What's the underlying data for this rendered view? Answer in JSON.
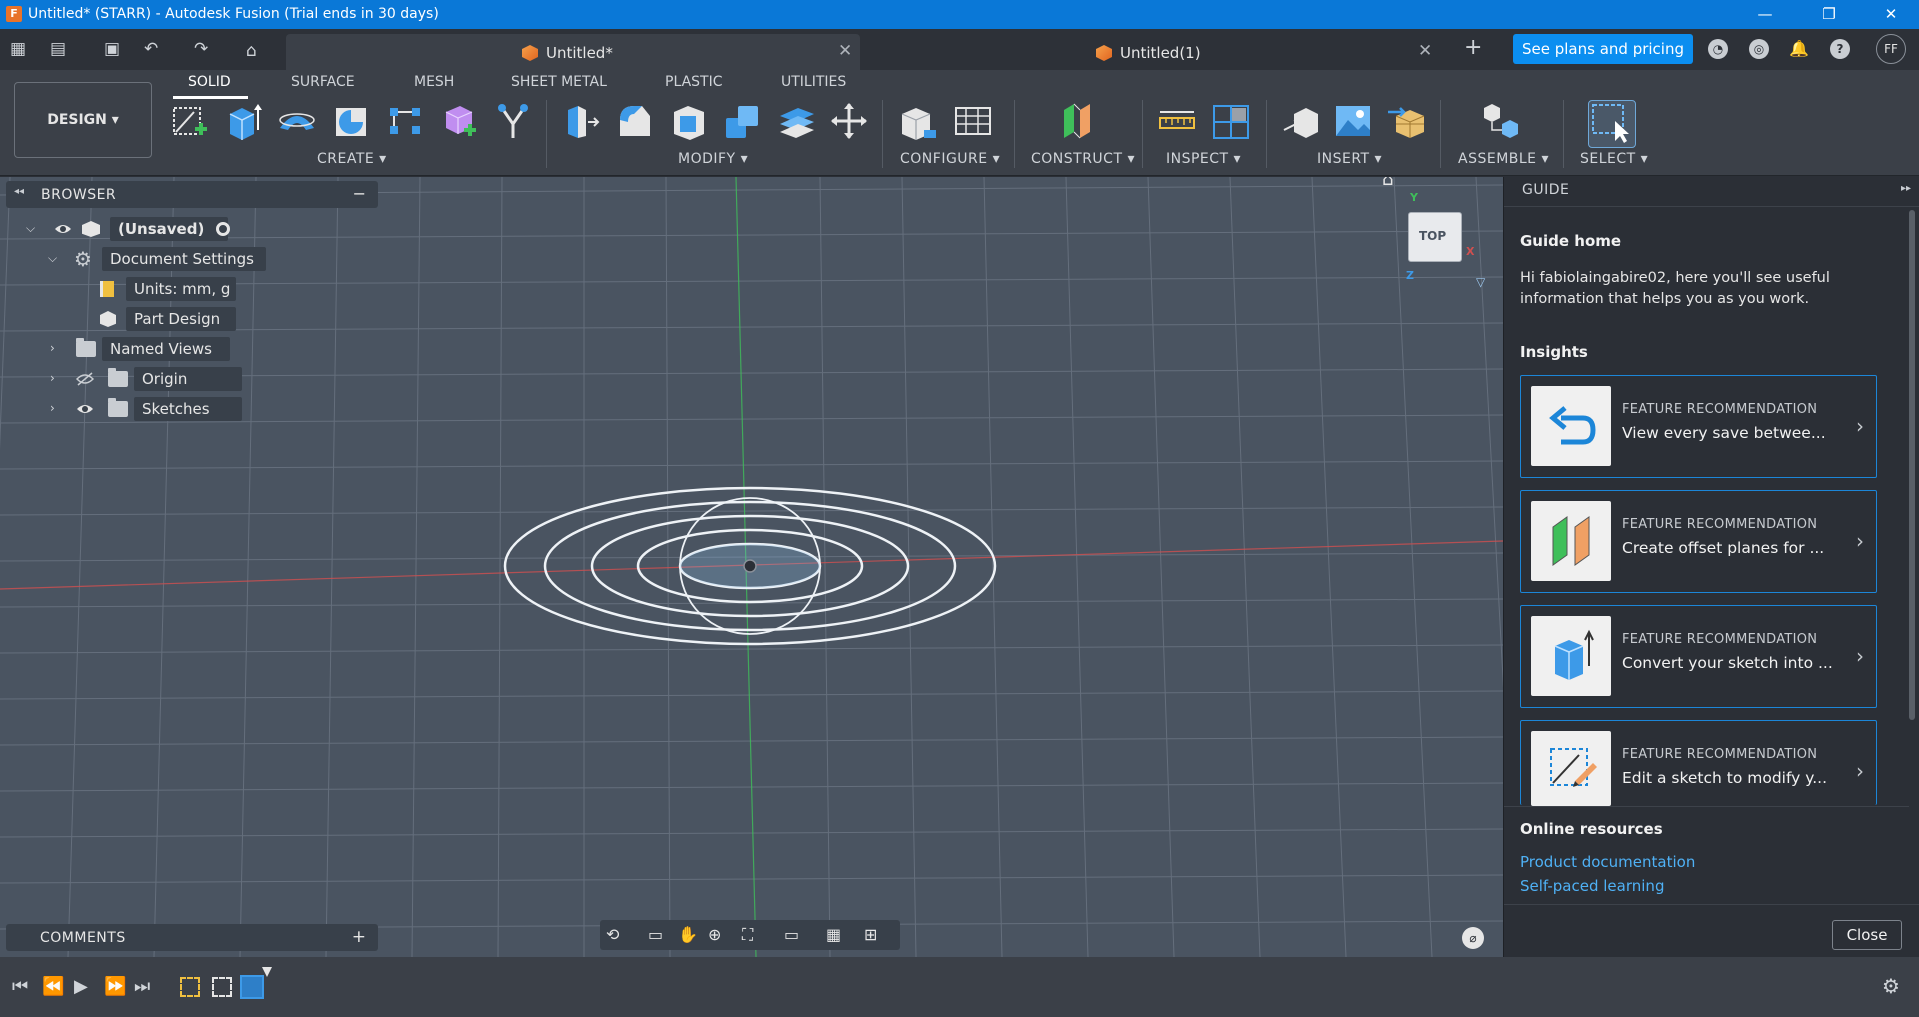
{
  "window": {
    "title": "Untitled* (STARR) - Autodesk Fusion (Trial ends in 30 days)",
    "app_icon": "F",
    "minimize": "—",
    "restore": "❐",
    "close": "✕"
  },
  "tabs": [
    {
      "label": "Untitled*",
      "close": "✕"
    },
    {
      "label": "Untitled(1)",
      "close": "✕"
    }
  ],
  "tab_add": "+",
  "header": {
    "plans_label": "See plans and pricing",
    "avatar": "FF"
  },
  "workspace": {
    "mode": "DESIGN ▾",
    "tabs": [
      "SOLID",
      "SURFACE",
      "MESH",
      "SHEET METAL",
      "PLASTIC",
      "UTILITIES"
    ]
  },
  "groups": {
    "create": "CREATE ▾",
    "modify": "MODIFY ▾",
    "configure": "CONFIGURE ▾",
    "construct": "CONSTRUCT ▾",
    "inspect": "INSPECT ▾",
    "insert": "INSERT ▾",
    "assemble": "ASSEMBLE ▾",
    "select": "SELECT ▾"
  },
  "browser": {
    "title": "BROWSER",
    "root": "(Unsaved)",
    "items": [
      {
        "label": "Document Settings"
      },
      {
        "label": "Units: mm, g"
      },
      {
        "label": "Part Design"
      },
      {
        "label": "Named Views"
      },
      {
        "label": "Origin"
      },
      {
        "label": "Sketches"
      }
    ]
  },
  "viewcube": {
    "face": "TOP",
    "y": "Y",
    "x": "X",
    "z": "Z"
  },
  "comments": {
    "title": "COMMENTS",
    "add": "+"
  },
  "guide": {
    "title": "GUIDE",
    "home": "Guide home",
    "intro": "Hi fabiolaingabire02, here you'll see useful information that helps you as you work.",
    "insights": "Insights",
    "cards": [
      {
        "kicker": "FEATURE RECOMMENDATION",
        "text": "View every save betwee..."
      },
      {
        "kicker": "FEATURE RECOMMENDATION",
        "text": "Create offset planes for ..."
      },
      {
        "kicker": "FEATURE RECOMMENDATION",
        "text": "Convert your sketch into ..."
      },
      {
        "kicker": "FEATURE RECOMMENDATION",
        "text": "Edit a sketch to modify y..."
      }
    ],
    "resources_title": "Online resources",
    "links": [
      "Product documentation",
      "Self-paced learning"
    ],
    "close": "Close"
  },
  "colors": {
    "accent": "#0b8ef0",
    "titlebar": "#0a78d7",
    "viewport": "#4a5461",
    "card_border": "#1c86d8",
    "link": "#4fb1f5"
  }
}
